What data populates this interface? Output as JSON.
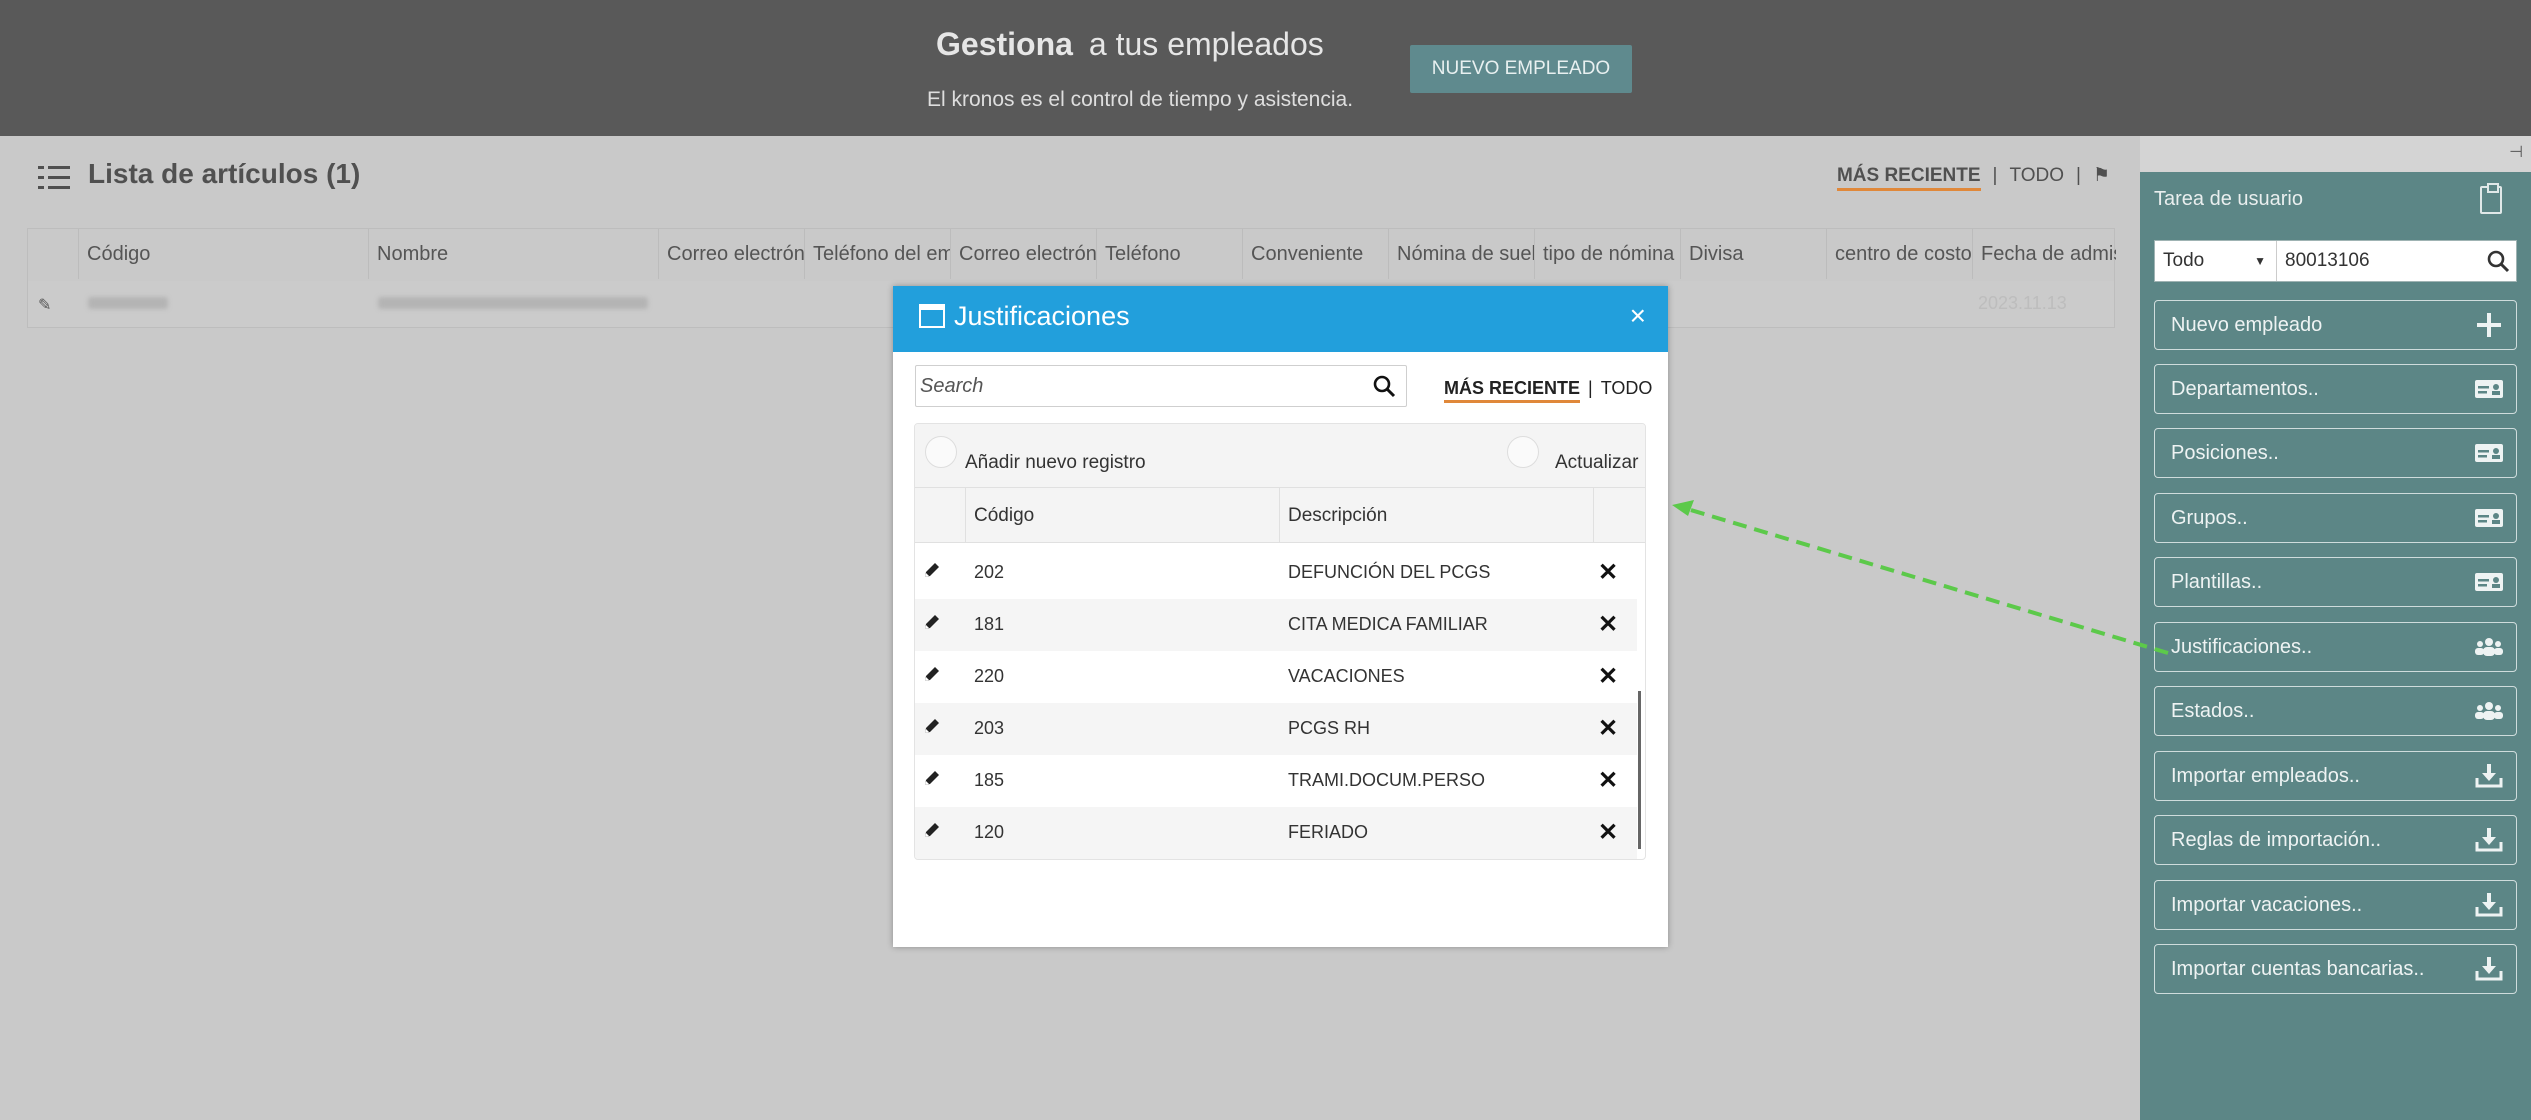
{
  "banner": {
    "title_bold": "Gestiona",
    "title_rest": "a tus empleados",
    "subtitle": "El kronos es el control de tiempo y asistencia.",
    "new_employee_button": "NUEVO EMPLEADO"
  },
  "list": {
    "title": "Lista de artículos (1)",
    "filter_recent": "MÁS RECIENTE",
    "filter_all": "TODO",
    "separator": "|",
    "columns": [
      "Código",
      "Nombre",
      "Correo electrón",
      "Teléfono del em",
      "Correo electrón",
      "Teléfono",
      "Conveniente",
      "Nómina de suel",
      "tipo de nómina",
      "Divisa",
      "centro de costo",
      "Fecha de admis"
    ],
    "row_date": "2023.11.13"
  },
  "sidebar": {
    "title": "Tarea de usuario",
    "filter_select": "Todo",
    "filter_input": "80013106",
    "items": [
      {
        "label": "Nuevo empleado",
        "icon": "plus-icon"
      },
      {
        "label": "Departamentos..",
        "icon": "id-card-icon"
      },
      {
        "label": "Posiciones..",
        "icon": "id-card-icon"
      },
      {
        "label": "Grupos..",
        "icon": "id-card-icon"
      },
      {
        "label": "Plantillas..",
        "icon": "id-card-icon"
      },
      {
        "label": "Justificaciones..",
        "icon": "users-icon"
      },
      {
        "label": "Estados..",
        "icon": "users-icon"
      },
      {
        "label": "Importar empleados..",
        "icon": "download-icon"
      },
      {
        "label": "Reglas de importación..",
        "icon": "download-icon"
      },
      {
        "label": "Importar vacaciones..",
        "icon": "download-icon"
      },
      {
        "label": "Importar cuentas bancarias..",
        "icon": "download-icon"
      }
    ]
  },
  "dialog": {
    "title": "Justificaciones",
    "close": "×",
    "search_placeholder": "Search",
    "filter_recent": "MÁS RECIENTE",
    "filter_all": "TODO",
    "separator": "|",
    "add_record": "Añadir nuevo registro",
    "refresh": "Actualizar",
    "col_code": "Código",
    "col_desc": "Descripción",
    "rows": [
      {
        "code": "202",
        "desc": "DEFUNCIÓN DEL PCGS"
      },
      {
        "code": "181",
        "desc": "CITA MEDICA FAMILIAR"
      },
      {
        "code": "220",
        "desc": "VACACIONES"
      },
      {
        "code": "203",
        "desc": "PCGS RH"
      },
      {
        "code": "185",
        "desc": "TRAMI.DOCUM.PERSO"
      },
      {
        "code": "120",
        "desc": "FERIADO"
      }
    ]
  },
  "colors": {
    "dialog_header": "#229fdc",
    "sidebar": "#5c8686",
    "accent_underline": "#e0883a",
    "arrow": "#5cc94a"
  }
}
